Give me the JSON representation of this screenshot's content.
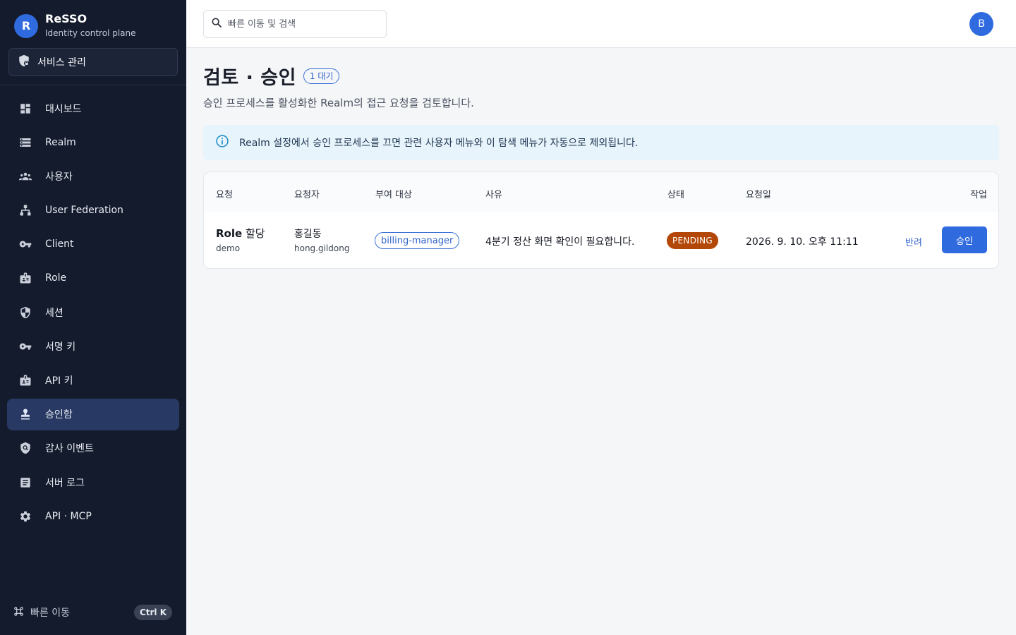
{
  "brand": {
    "logo_letter": "R",
    "name": "ReSSO",
    "subtitle": "Identity control plane"
  },
  "service_button": {
    "label": "서비스 관리",
    "icon": "shield-lock-icon"
  },
  "nav": [
    {
      "label": "대시보드",
      "icon": "dashboard-icon"
    },
    {
      "label": "Realm",
      "icon": "storage-icon"
    },
    {
      "label": "사용자",
      "icon": "people-icon"
    },
    {
      "label": "User Federation",
      "icon": "hierarchy-icon"
    },
    {
      "label": "Client",
      "icon": "key-icon"
    },
    {
      "label": "Role",
      "icon": "badge-icon"
    },
    {
      "label": "세션",
      "icon": "shield-icon"
    },
    {
      "label": "서명 키",
      "icon": "key-icon"
    },
    {
      "label": "API 키",
      "icon": "badge-icon"
    },
    {
      "label": "승인함",
      "icon": "approval-stamp-icon",
      "active": true
    },
    {
      "label": "감사 이벤트",
      "icon": "audit-shield-icon"
    },
    {
      "label": "서버 로그",
      "icon": "article-icon"
    },
    {
      "label": "API · MCP",
      "icon": "gear-icon"
    }
  ],
  "footer": {
    "label": "빠른 이동",
    "shortcut": "Ctrl K",
    "icon": "command-icon"
  },
  "topbar": {
    "search_placeholder": "빠른 이동 및 검색",
    "avatar_letter": "B"
  },
  "page": {
    "title": "검토 · 승인",
    "badge": "1 대기",
    "subtitle": "승인 프로세스를 활성화한 Realm의 접근 요청을 검토합니다."
  },
  "info": {
    "text": "Realm 설정에서 승인 프로세스를 끄면 관련 사용자 메뉴와 이 탐색 메뉴가 자동으로 제외됩니다."
  },
  "table": {
    "headers": [
      "요청",
      "요청자",
      "부여 대상",
      "사유",
      "상태",
      "요청일",
      "작업"
    ],
    "rows": [
      {
        "type_bold": "Role",
        "type_rest": " 할당",
        "realm": "demo",
        "requester_name": "홍길동",
        "requester_id": "hong.gildong",
        "target": "billing-manager",
        "reason": "4분기 정산 화면 확인이 필요합니다.",
        "status": "PENDING",
        "date": "2026. 9. 10. 오후 11:11",
        "reject_label": "반려",
        "approve_label": "승인"
      }
    ]
  },
  "colors": {
    "sidebar_bg": "#141b2d",
    "accent": "#2f6bde",
    "active_nav": "#283a63",
    "pending": "#b34707",
    "info_bg": "#e7f4fb"
  }
}
